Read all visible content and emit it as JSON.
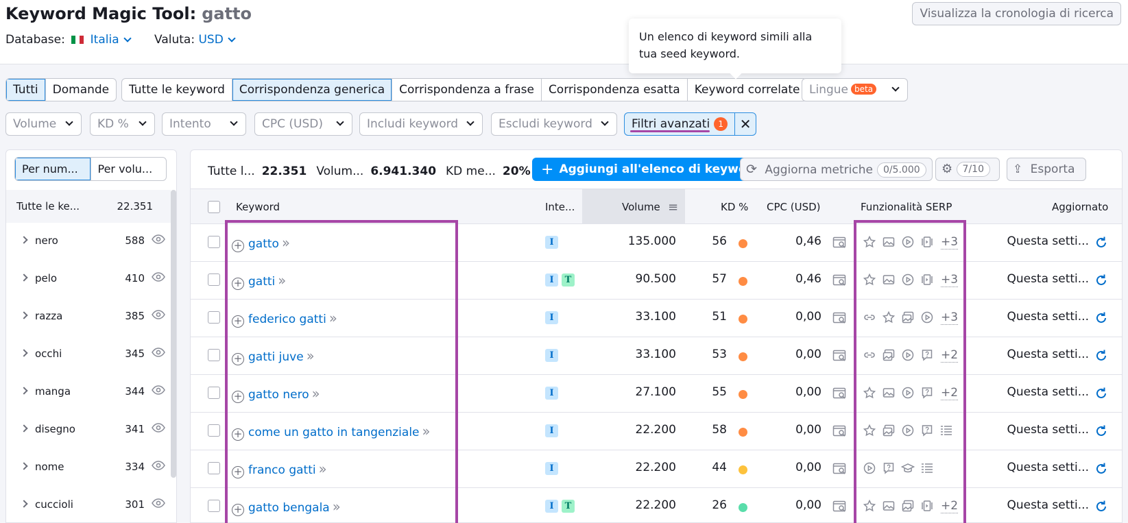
{
  "header": {
    "title": "Keyword Magic Tool:",
    "seed": "gatto",
    "database_label": "Database:",
    "database_value": "Italia",
    "currency_label": "Valuta:",
    "currency_value": "USD",
    "history_button": "Visualizza la cronologia di ricerca"
  },
  "tooltip": {
    "text": "Un elenco di keyword simili alla tua seed keyword."
  },
  "tabs_type": [
    "Tutti",
    "Domande"
  ],
  "tabs_match": [
    "Tutte le keyword",
    "Corrispondenza generica",
    "Corrispondenza a frase",
    "Corrispondenza esatta",
    "Keyword correlate"
  ],
  "languages": {
    "label": "Lingue",
    "badge": "beta"
  },
  "filters": {
    "volume": "Volume",
    "kd": "KD %",
    "intent": "Intento",
    "cpc": "CPC (USD)",
    "include": "Includi keyword",
    "exclude": "Escludi keyword",
    "advanced": "Filtri avanzati",
    "advanced_count": "1"
  },
  "sidebar": {
    "toggle": [
      "Per num...",
      "Per volu..."
    ],
    "all_label": "Tutte le ke...",
    "all_count": "22.351",
    "groups": [
      {
        "word": "nero",
        "count": "588"
      },
      {
        "word": "pelo",
        "count": "410"
      },
      {
        "word": "razza",
        "count": "385"
      },
      {
        "word": "occhi",
        "count": "345"
      },
      {
        "word": "manga",
        "count": "344"
      },
      {
        "word": "disegno",
        "count": "341"
      },
      {
        "word": "nome",
        "count": "334"
      },
      {
        "word": "cuccioli",
        "count": "301"
      }
    ]
  },
  "summary": {
    "all_label": "Tutte l...",
    "all_value": "22.351",
    "volume_label": "Volum...",
    "volume_value": "6.941.340",
    "kd_label": "KD me...",
    "kd_value": "20%"
  },
  "toolbar": {
    "add_button": "Aggiungi all'elenco di keyword",
    "refresh_button": "Aggiorna metriche",
    "refresh_quota": "0/5.000",
    "columns_count": "7/10",
    "export_button": "Esporta"
  },
  "table": {
    "headers": {
      "keyword": "Keyword",
      "intent": "Inte...",
      "volume": "Volume",
      "kd": "KD %",
      "cpc": "CPC (USD)",
      "serp": "Funzionalità SERP",
      "updated": "Aggiornato"
    },
    "rows": [
      {
        "keyword": "gatto",
        "intents": [
          "I"
        ],
        "volume": "135.000",
        "kd": "56",
        "cpc": "0,46",
        "features": [
          "star-icon",
          "image-icon",
          "video-icon",
          "carousel-icon"
        ],
        "more": "+3",
        "updated": "Questa setti..."
      },
      {
        "keyword": "gatti",
        "intents": [
          "I",
          "T"
        ],
        "volume": "90.500",
        "kd": "57",
        "cpc": "0,46",
        "features": [
          "star-icon",
          "image-icon",
          "video-icon",
          "carousel-icon"
        ],
        "more": "+3",
        "updated": "Questa setti..."
      },
      {
        "keyword": "federico gatti",
        "intents": [
          "I"
        ],
        "volume": "33.100",
        "kd": "51",
        "cpc": "0,00",
        "features": [
          "link-icon",
          "star-icon",
          "images-icon",
          "video-icon"
        ],
        "more": "+3",
        "updated": "Questa setti..."
      },
      {
        "keyword": "gatti juve",
        "intents": [
          "I"
        ],
        "volume": "33.100",
        "kd": "53",
        "cpc": "0,00",
        "features": [
          "link-icon",
          "images-icon",
          "video-icon",
          "question-icon"
        ],
        "more": "+2",
        "updated": "Questa setti..."
      },
      {
        "keyword": "gatto nero",
        "intents": [
          "I"
        ],
        "volume": "27.100",
        "kd": "55",
        "cpc": "0,00",
        "features": [
          "star-icon",
          "image-icon",
          "video-icon",
          "question-icon"
        ],
        "more": "+2",
        "updated": "Questa setti..."
      },
      {
        "keyword": "come un gatto in tangenziale",
        "intents": [
          "I"
        ],
        "volume": "22.200",
        "kd": "58",
        "cpc": "0,00",
        "features": [
          "star-icon",
          "images-icon",
          "video-icon",
          "question-icon",
          "list-icon"
        ],
        "more": "",
        "updated": "Questa setti..."
      },
      {
        "keyword": "franco gatti",
        "intents": [
          "I"
        ],
        "volume": "22.200",
        "kd": "44",
        "cpc": "0,00",
        "features": [
          "video-icon",
          "question-icon",
          "graduation-icon",
          "list-icon"
        ],
        "more": "",
        "updated": "Questa setti..."
      },
      {
        "keyword": "gatto bengala",
        "intents": [
          "I",
          "T"
        ],
        "volume": "22.200",
        "kd": "26",
        "cpc": "0,00",
        "features": [
          "star-icon",
          "image-icon",
          "images-icon",
          "carousel-icon"
        ],
        "more": "+2",
        "updated": "Questa setti..."
      }
    ]
  },
  "colors": {
    "accent": "#006dca",
    "primary_button": "#008ff8",
    "highlight": "#a646a6",
    "kd_orange": "#ff8c43",
    "kd_yellow": "#fdc23c",
    "kd_green": "#59ddaa"
  }
}
